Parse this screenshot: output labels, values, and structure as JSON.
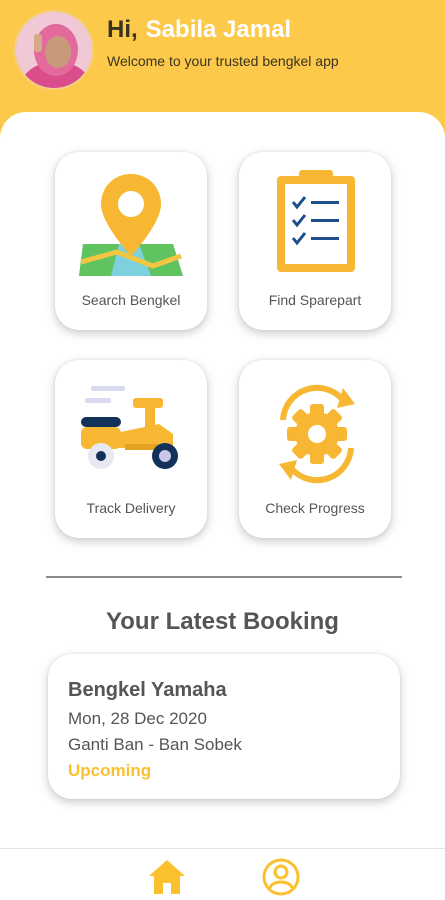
{
  "header": {
    "greeting": "Hi,",
    "user_name": "Sabila Jamal",
    "subtitle": "Welcome to your trusted bengkel app",
    "avatar_icon": "user-photo"
  },
  "menu": [
    {
      "label": "Search Bengkel",
      "icon": "map-pin-icon"
    },
    {
      "label": "Find Sparepart",
      "icon": "checklist-clipboard-icon"
    },
    {
      "label": "Track Delivery",
      "icon": "scooter-icon"
    },
    {
      "label": "Check Progress",
      "icon": "gear-refresh-icon"
    }
  ],
  "latest_booking": {
    "title": "Your Latest Booking",
    "shop": "Bengkel Yamaha",
    "date": "Mon, 28 Dec 2020",
    "service": "Ganti Ban - Ban Sobek",
    "status": "Upcoming"
  },
  "bottom_nav": [
    {
      "name": "home",
      "icon": "home-icon"
    },
    {
      "name": "profile",
      "icon": "profile-icon"
    }
  ],
  "colors": {
    "accent": "#fcc94a",
    "status": "#fbc02d",
    "text": "#555555"
  }
}
